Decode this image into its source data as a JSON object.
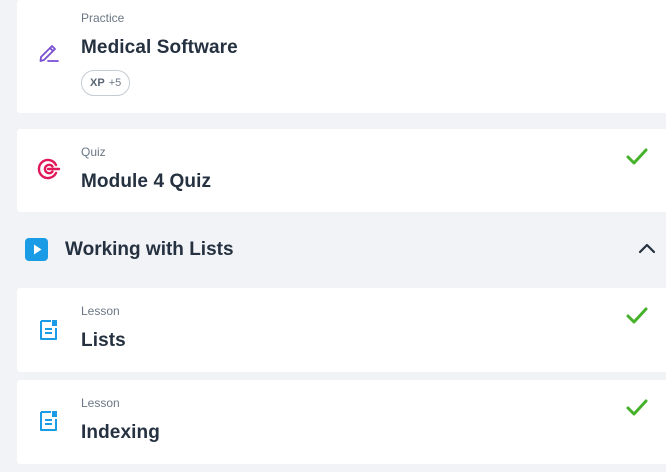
{
  "practice_card": {
    "type": "Practice",
    "title": "Medical Software",
    "icon": "pencil-edit-icon",
    "xp": {
      "label": "XP",
      "value": "+5"
    }
  },
  "quiz_card": {
    "type": "Quiz",
    "title": "Module 4 Quiz",
    "icon": "target-icon",
    "completed": true
  },
  "section": {
    "title": "Working with Lists",
    "icon": "play-icon",
    "expanded": true
  },
  "lessons": [
    {
      "type": "Lesson",
      "title": "Lists",
      "icon": "document-icon",
      "completed": true
    },
    {
      "type": "Lesson",
      "title": "Indexing",
      "icon": "document-icon",
      "completed": true
    }
  ],
  "colors": {
    "accent_purple": "#7a4fd0",
    "accent_pink": "#e0195a",
    "accent_blue": "#1a9be6",
    "success_green": "#46b12a",
    "background": "#f1f3f6"
  }
}
